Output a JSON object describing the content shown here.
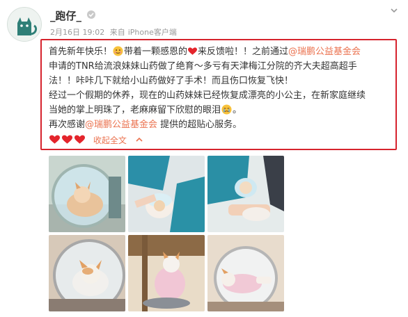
{
  "post": {
    "username": "_跑仔_",
    "timestamp": "2月16日 19:02",
    "source_prefix": "来自",
    "source": "iPhone客户端",
    "text": {
      "l1a": "首先新年快乐！",
      "l1b": "带着一颗感恩的",
      "l1c": "来反馈啦！！之前通过",
      "mention1": "@瑞鹏公益基金会",
      "l2": "申请的TNR给流浪妹妹山药做了绝育～多亏有天津梅江分院的齐大夫超高超手",
      "l3": "法！！咔咔几下就给小山药做好了手术！而且伤口恢复飞快！",
      "l4": "经过一个假期的休养，现在的山药妹妹已经恢复成漂亮的小公主，在新家庭继续",
      "l5a": "当她的掌上明珠了，老麻麻留下欣慰的眼泪",
      "l5b": "。",
      "l6a": "再次感谢",
      "mention2": "@瑞鹏公益基金会",
      "l6b": " 提供的超贴心服务。"
    },
    "collapse_label": "收起全文"
  },
  "icons": {
    "verify": "verified-badge-icon",
    "chevron": "chevron-down-icon",
    "heart": "heart-icon",
    "emoji_hug": "smiley-emoji-icon",
    "emoji_cry": "crying-emoji-icon",
    "collapse_arrow": "chevron-up-icon"
  },
  "colors": {
    "link": "#eb7350",
    "highlight_border": "#d6232d",
    "heart": "#e4252c"
  },
  "gallery": {
    "photos": [
      {
        "name": "cat-in-carrier-photo"
      },
      {
        "name": "vet-exam-photo"
      },
      {
        "name": "vet-treatment-photo"
      },
      {
        "name": "cat-in-bubble-carrier-photo"
      },
      {
        "name": "cat-in-recovery-suit-photo"
      },
      {
        "name": "cat-lying-in-carrier-photo"
      }
    ]
  }
}
